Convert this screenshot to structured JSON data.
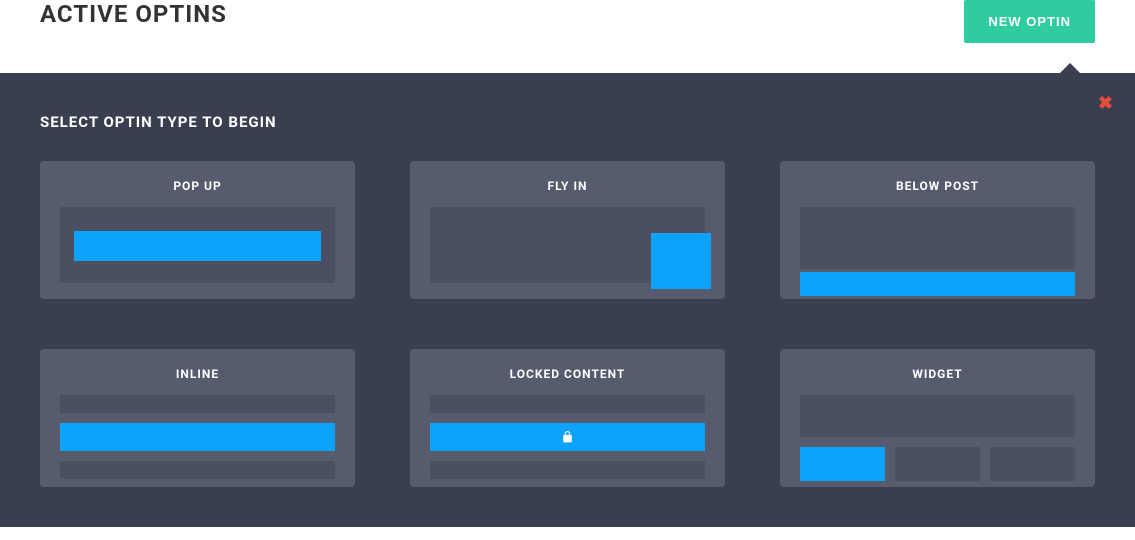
{
  "header": {
    "title": "ACTIVE OPTINS",
    "new_optin_label": "NEW OPTIN"
  },
  "panel": {
    "title": "SELECT OPTIN TYPE TO BEGIN",
    "cards": {
      "popup": {
        "label": "POP UP"
      },
      "flyin": {
        "label": "FLY IN"
      },
      "belowpost": {
        "label": "BELOW POST"
      },
      "inline": {
        "label": "INLINE"
      },
      "locked": {
        "label": "LOCKED CONTENT"
      },
      "widget": {
        "label": "WIDGET"
      }
    }
  },
  "colors": {
    "accent": "#0da2fc",
    "button": "#2ecc9e",
    "panel_bg": "#3a3f50",
    "card_bg": "#565b6e",
    "preview_bg": "#4a4f62",
    "close": "#e74c3c"
  }
}
